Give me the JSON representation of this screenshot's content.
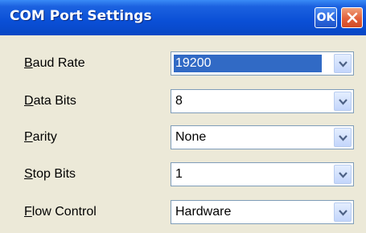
{
  "window": {
    "title": "COM Port Settings",
    "ok_label": "OK"
  },
  "fields": [
    {
      "label_key": "B",
      "label_rest": "aud Rate",
      "value": "19200",
      "selected": true
    },
    {
      "label_key": "D",
      "label_rest": "ata Bits",
      "value": "8",
      "selected": false
    },
    {
      "label_key": "P",
      "label_rest": "arity",
      "value": "None",
      "selected": false
    },
    {
      "label_key": "S",
      "label_rest": "top Bits",
      "value": "1",
      "selected": false
    },
    {
      "label_key": "F",
      "label_rest": "low Control",
      "value": "Hardware",
      "selected": false
    }
  ],
  "icons": {
    "close": "close-icon",
    "dropdown": "chevron-down-icon"
  },
  "colors": {
    "titlebar": "#0a4fd6",
    "selection": "#316ac5",
    "close_button": "#e2603a",
    "dialog_background": "#ece9d8"
  }
}
